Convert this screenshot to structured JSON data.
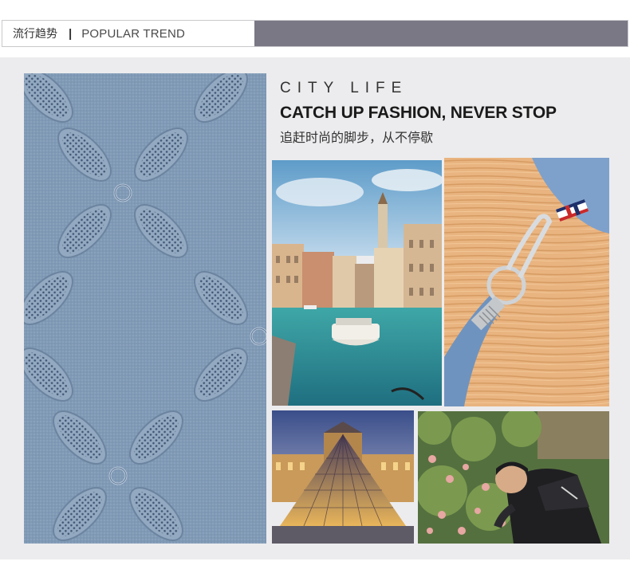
{
  "header": {
    "cn_label": "流行趋势",
    "separator": "|",
    "en_label": "POPULAR TREND"
  },
  "heading": {
    "eyebrow": "CITY LIFE",
    "title": "CATCH UP FASHION, NEVER STOP",
    "subtitle_cn": "追赶时尚的脚步，从不停歇"
  },
  "colors": {
    "header_fill": "#7b7885",
    "panel_bg": "#ececee",
    "leather": "#7e97b3"
  },
  "images": [
    {
      "name": "leather-texture"
    },
    {
      "name": "venice-canal-photo"
    },
    {
      "name": "wallet-clasp-photo"
    },
    {
      "name": "louvre-pyramid-photo"
    },
    {
      "name": "man-in-rose-garden-photo"
    }
  ]
}
